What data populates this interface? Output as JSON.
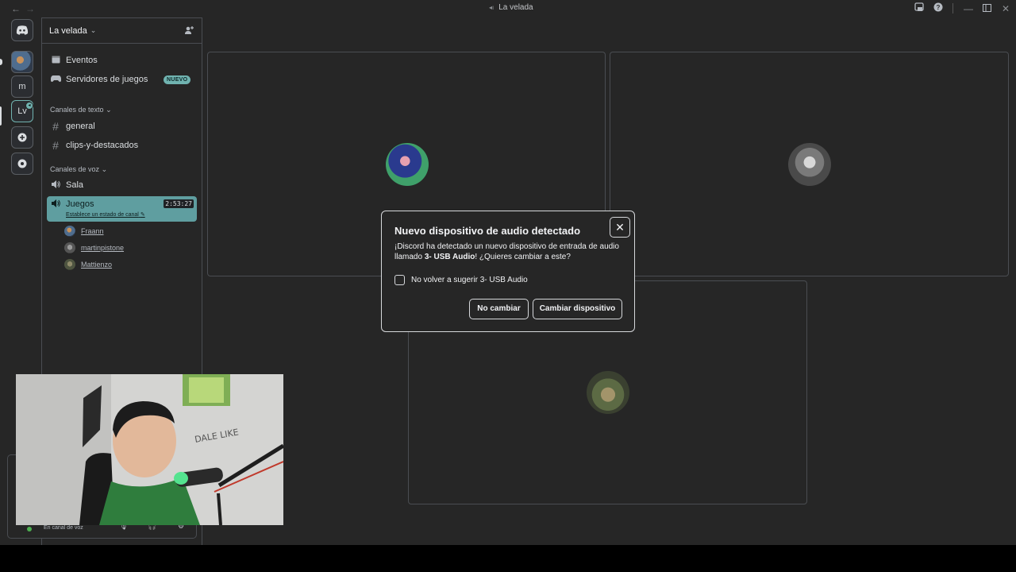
{
  "window": {
    "title": "La velada"
  },
  "server_rail": {
    "items": [
      "discord-home",
      "server-avatar",
      "m",
      "Lv",
      "add-server",
      "explore"
    ],
    "labels": {
      "m": "m",
      "lv": "Lv"
    }
  },
  "sidebar": {
    "guild_name": "La velada",
    "nav": {
      "events": "Eventos",
      "game_servers": "Servidores de juegos",
      "new_badge": "NUEVO"
    },
    "text_category": "Canales de texto",
    "text_channels": [
      "general",
      "clips-y-destacados"
    ],
    "voice_category": "Canales de voz",
    "voice_channels": {
      "sala": "Sala",
      "juegos": "Juegos",
      "juegos_timer": "2:53:27",
      "juegos_status": "Establece un estado de canal"
    },
    "voice_users": [
      "Fraann",
      "martinpistone",
      "Mattienzo"
    ],
    "panel": {
      "voice_status": "En canal de voz"
    }
  },
  "modal": {
    "title": "Nuevo dispositivo de audio detectado",
    "body_prefix": "¡Discord ha detectado un nuevo dispositivo de entrada de audio llamado ",
    "device_name": "3- USB Audio",
    "body_suffix": "! ¿Quieres cambiar a este?",
    "checkbox_label": "No volver a sugerir 3- USB Audio",
    "checkbox_checked": false,
    "cancel_label": "No cambiar",
    "confirm_label": "Cambiar dispositivo",
    "close_glyph": "✕"
  },
  "colors": {
    "accent": "#5f9ea0",
    "background": "#262626",
    "border": "#4a4d52"
  }
}
